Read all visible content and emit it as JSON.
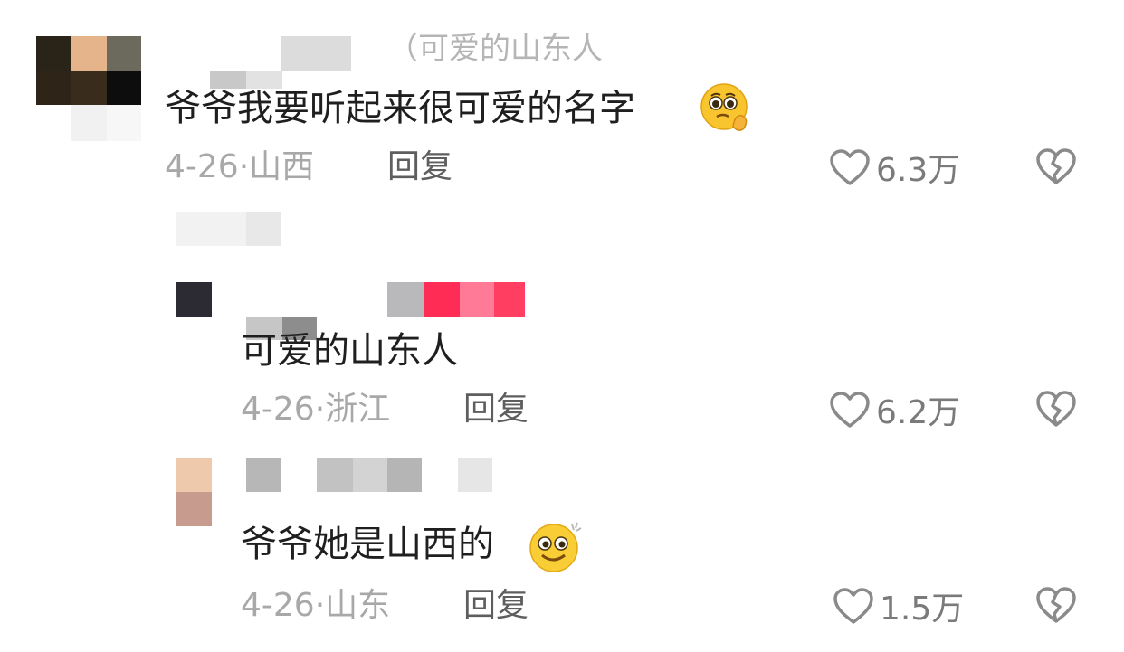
{
  "comments": [
    {
      "reply_hint": "（可爱的山东人",
      "text": "爷爷我要听起来很可爱的名字",
      "emoji": "pleading-hands-emoji",
      "date": "4-26",
      "region": "山西",
      "reply_label": "回复",
      "likes": "6.3万"
    },
    {
      "text": "可爱的山东人",
      "date": "4-26",
      "region": "浙江",
      "reply_label": "回复",
      "likes": "6.2万"
    },
    {
      "text": "爷爷她是山西的",
      "emoji": "dizzy-smile-emoji",
      "date": "4-26",
      "region": "山东",
      "reply_label": "回复",
      "likes": "1.5万"
    }
  ],
  "meta_separator": "·",
  "icons": {
    "like": "heart-outline-icon",
    "dislike": "broken-heart-icon"
  },
  "colors": {
    "text": "#1f1f1f",
    "meta": "#a8a8a8",
    "reply": "#5e5e5e",
    "icon": "#8a8a8a"
  }
}
